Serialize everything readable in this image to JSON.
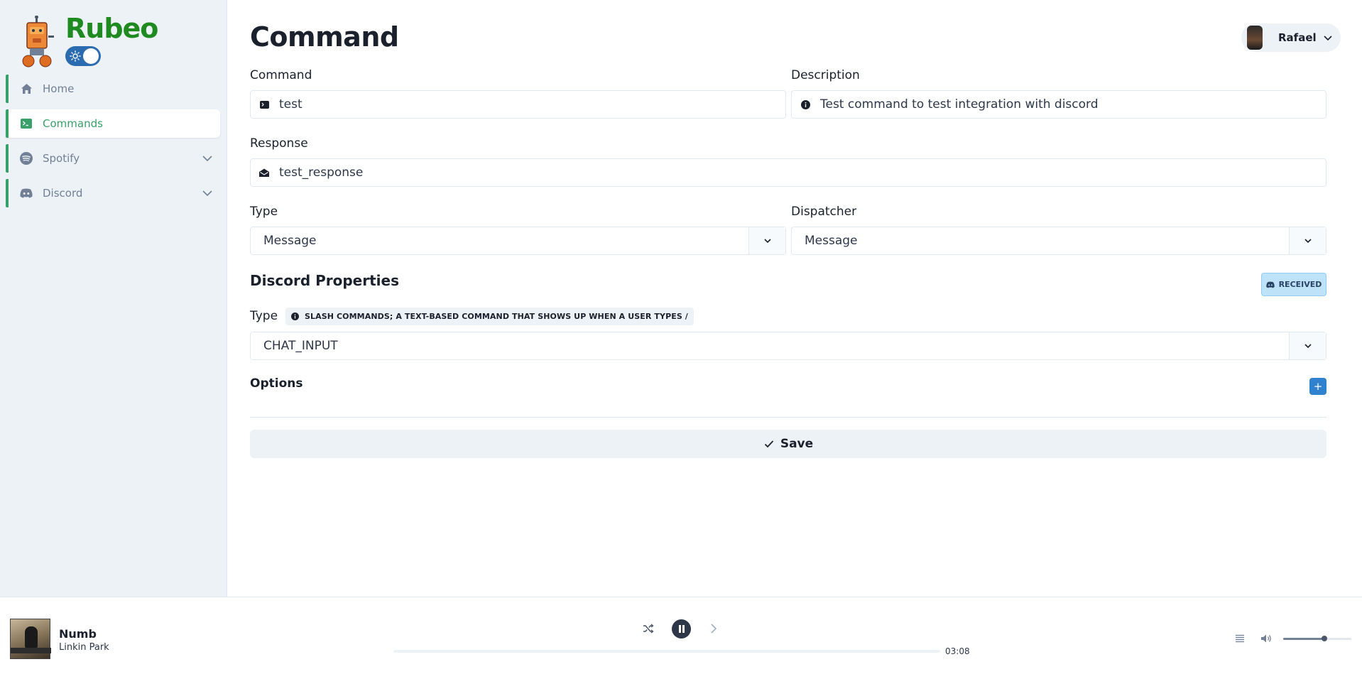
{
  "brand": {
    "name": "Rubeo"
  },
  "sidebar": {
    "items": [
      {
        "label": "Home",
        "active": false,
        "expandable": false,
        "icon": "home-icon"
      },
      {
        "label": "Commands",
        "active": true,
        "expandable": false,
        "icon": "terminal-icon"
      },
      {
        "label": "Spotify",
        "active": false,
        "expandable": true,
        "icon": "spotify-icon"
      },
      {
        "label": "Discord",
        "active": false,
        "expandable": true,
        "icon": "discord-icon"
      }
    ]
  },
  "header": {
    "title": "Command",
    "user": {
      "name": "Rafael"
    }
  },
  "form": {
    "command": {
      "label": "Command",
      "value": "test",
      "icon": "terminal-icon"
    },
    "description": {
      "label": "Description",
      "value": "Test command to test integration with discord",
      "icon": "info-icon"
    },
    "response": {
      "label": "Response",
      "value": "test_response",
      "icon": "envelope-icon"
    },
    "type": {
      "label": "Type",
      "value": "Message"
    },
    "dispatcher": {
      "label": "Dispatcher",
      "value": "Message"
    }
  },
  "discord": {
    "title": "Discord Properties",
    "badge": "RECEIVED",
    "type_label": "Type",
    "type_hint": "SLASH COMMANDS; A TEXT-BASED COMMAND THAT SHOWS UP WHEN A USER TYPES /",
    "type_value": "CHAT_INPUT",
    "options_label": "Options",
    "add_label": "+"
  },
  "actions": {
    "save_label": "Save"
  },
  "player": {
    "track": "Numb",
    "artist": "Linkin Park",
    "time": "03:08",
    "progress": 0,
    "volume": 0.6
  },
  "colors": {
    "brand": "#1f8a1f",
    "accent": "#38a169",
    "primary": "#3182ce",
    "sidebar_bg": "#edf2f7"
  }
}
